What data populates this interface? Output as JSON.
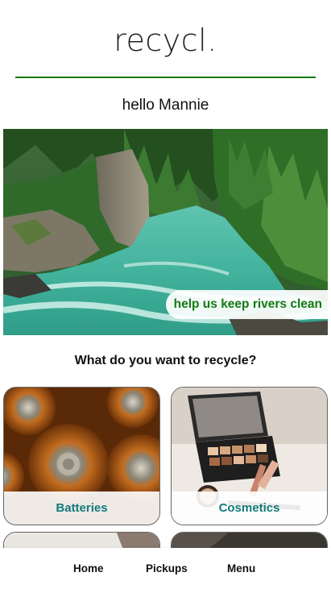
{
  "header": {
    "app_title": "recycl.",
    "greeting": "hello Mannie"
  },
  "hero": {
    "caption": "help us keep rivers clean",
    "caption_color": "#137a13"
  },
  "recycle": {
    "question": "What do you want to recycle?",
    "categories": [
      {
        "label": "Batteries"
      },
      {
        "label": "Cosmetics"
      }
    ],
    "label_color": "#127a7a"
  },
  "nav": {
    "items": [
      {
        "label": "Home"
      },
      {
        "label": "Pickups"
      },
      {
        "label": "Menu"
      }
    ]
  },
  "colors": {
    "accent_green": "#137a13",
    "teal": "#127a7a"
  }
}
